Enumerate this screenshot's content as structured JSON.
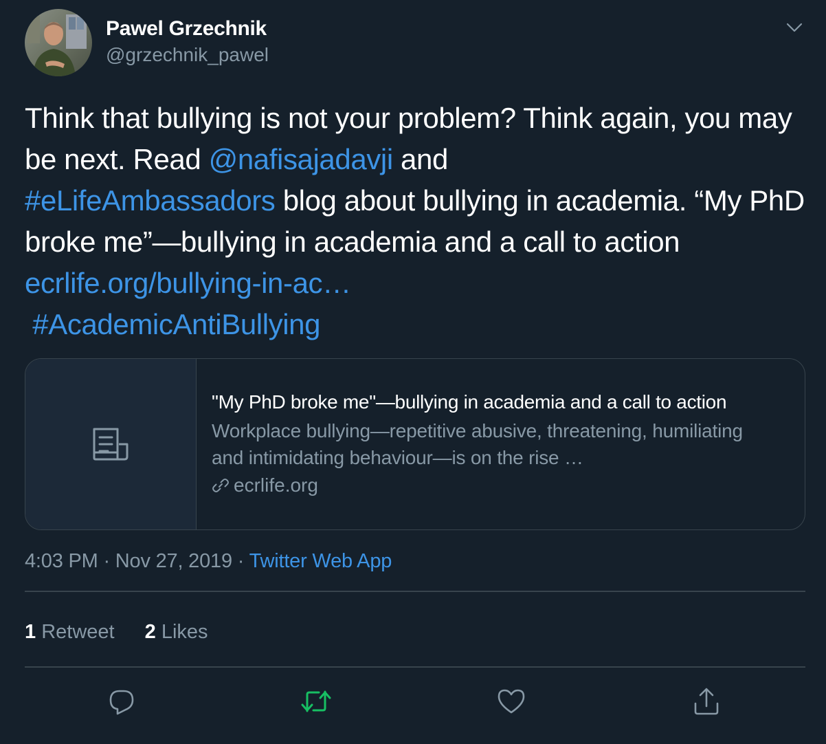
{
  "author": {
    "display_name": "Pawel Grzechnik",
    "handle": "@grzechnik_pawel"
  },
  "tweet": {
    "line1": "Think that bullying is not your problem? Think again, you may be next. Read ",
    "mention": "@nafisajadavji",
    "and_text": " and ",
    "hashtag1": "#eLifeAmbassadors",
    "line2": " blog about bullying in academia. “My PhD broke me”—bullying in academia and a call to action ",
    "link": "ecrlife.org/bullying-in-ac…",
    "hashtag2": "#AcademicAntiBullying"
  },
  "card": {
    "icon": "article-icon",
    "title": "\"My PhD broke me\"—bullying in academia and a call to action",
    "description": "Workplace bullying—repetitive abusive, threatening, humiliating and intimidating behaviour—is on the rise …",
    "domain": "ecrlife.org"
  },
  "meta": {
    "time": "4:03 PM",
    "date": "Nov 27, 2019",
    "separator": " · ",
    "app": "Twitter Web App"
  },
  "stats": {
    "retweets_count": "1",
    "retweets_label": "Retweet",
    "likes_count": "2",
    "likes_label": "Likes"
  },
  "colors": {
    "background": "#15202b",
    "link": "#3d94e6",
    "secondary_text": "#8899a6",
    "border": "#38444d",
    "retweet_active": "#17bf63"
  },
  "actions": [
    "reply-icon",
    "retweet-icon",
    "like-icon",
    "share-icon"
  ]
}
